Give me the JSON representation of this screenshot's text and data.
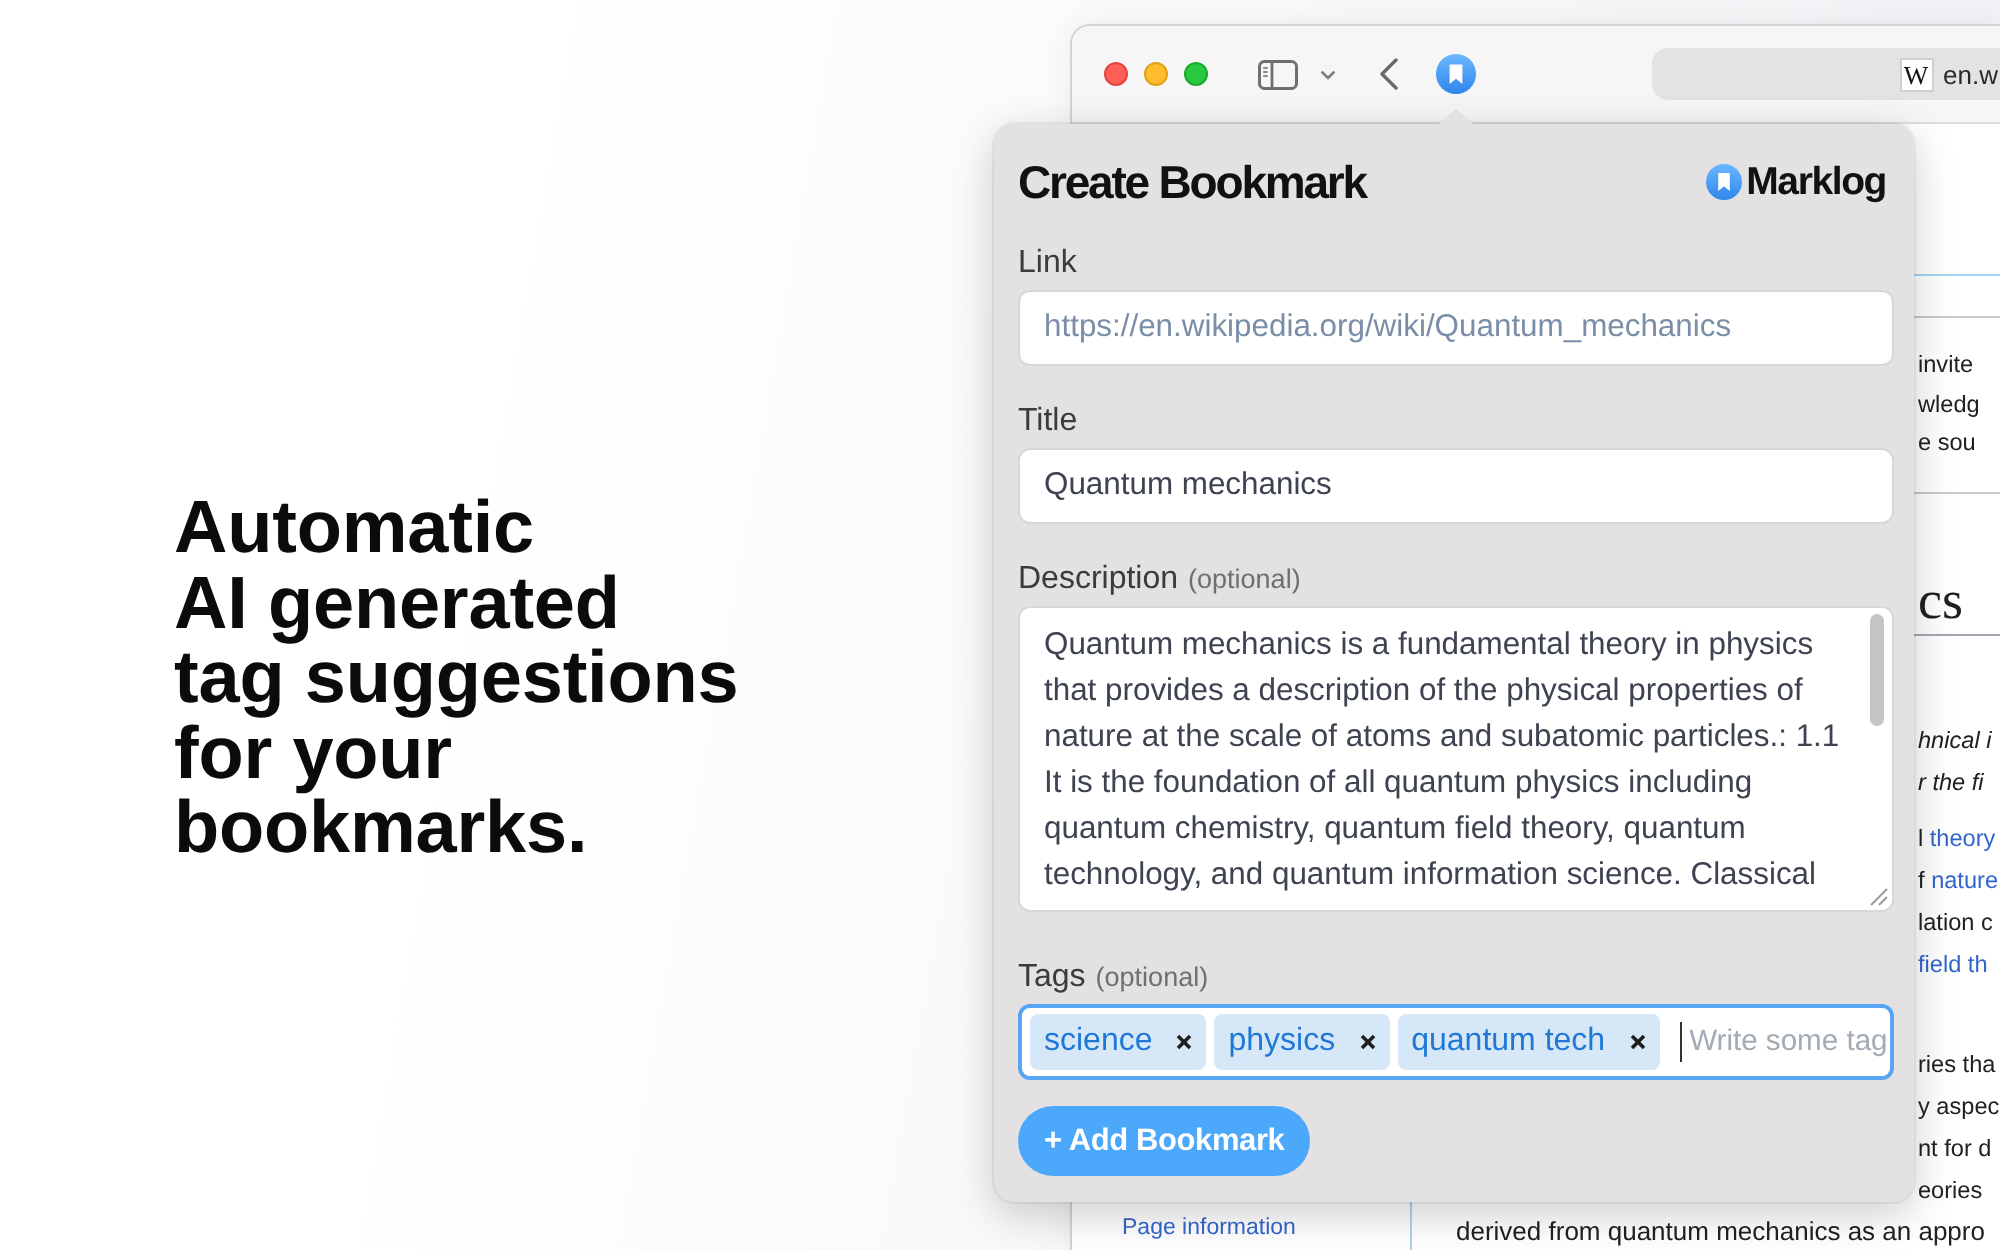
{
  "headline": [
    "Automatic",
    "AI generated",
    "tag suggestions",
    "for your",
    "bookmarks."
  ],
  "browser": {
    "address_bar": {
      "favicon": "W",
      "url": "en.w"
    },
    "sidebar_links": [
      "Page information"
    ],
    "page": {
      "notice_lines": [
        "invite",
        "wledg",
        "e sou"
      ],
      "heading": "cs",
      "hatnote_lines": [
        "hnical i",
        "r the fi"
      ],
      "paragraphs": [
        {
          "lines": [
            {
              "text": "l ",
              "link_text": "theory"
            },
            {
              "text": "f ",
              "link_text": "nature"
            },
            {
              "text": "lation c"
            },
            {
              "link_text": "field th"
            }
          ]
        },
        {
          "lines": [
            {
              "text": "ries tha"
            },
            {
              "text": "y aspec"
            },
            {
              "text": "nt for d"
            },
            {
              "text": "eories"
            }
          ]
        }
      ],
      "last_line": "derived from quantum mechanics as an appro"
    }
  },
  "popup": {
    "title": "Create Bookmark",
    "brand": "Marklog",
    "fields": [
      {
        "kind": "input",
        "label": "Link",
        "value": "https://en.wikipedia.org/wiki/Quantum_mechanics",
        "readonly": true,
        "focused": false
      },
      {
        "kind": "input",
        "label": "Title",
        "value": "Quantum mechanics",
        "readonly": false,
        "focused": false
      },
      {
        "kind": "textarea",
        "label": "Description",
        "hint": "(optional)",
        "value": "Quantum mechanics is a fundamental theory in physics that provides a description of the physical properties of nature at the scale of atoms and subatomic particles.: 1.1 It is the foundation of all quantum physics including quantum chemistry, quantum field theory, quantum technology, and quantum information science. Classical",
        "readonly": false,
        "focused": false
      },
      {
        "kind": "tags",
        "label": "Tags",
        "hint": "(optional)",
        "tags": [
          "science",
          "physics",
          "quantum tech"
        ],
        "placeholder": "Write some tag",
        "readonly": false,
        "focused": true
      }
    ],
    "submit": "+ Add Bookmark"
  }
}
